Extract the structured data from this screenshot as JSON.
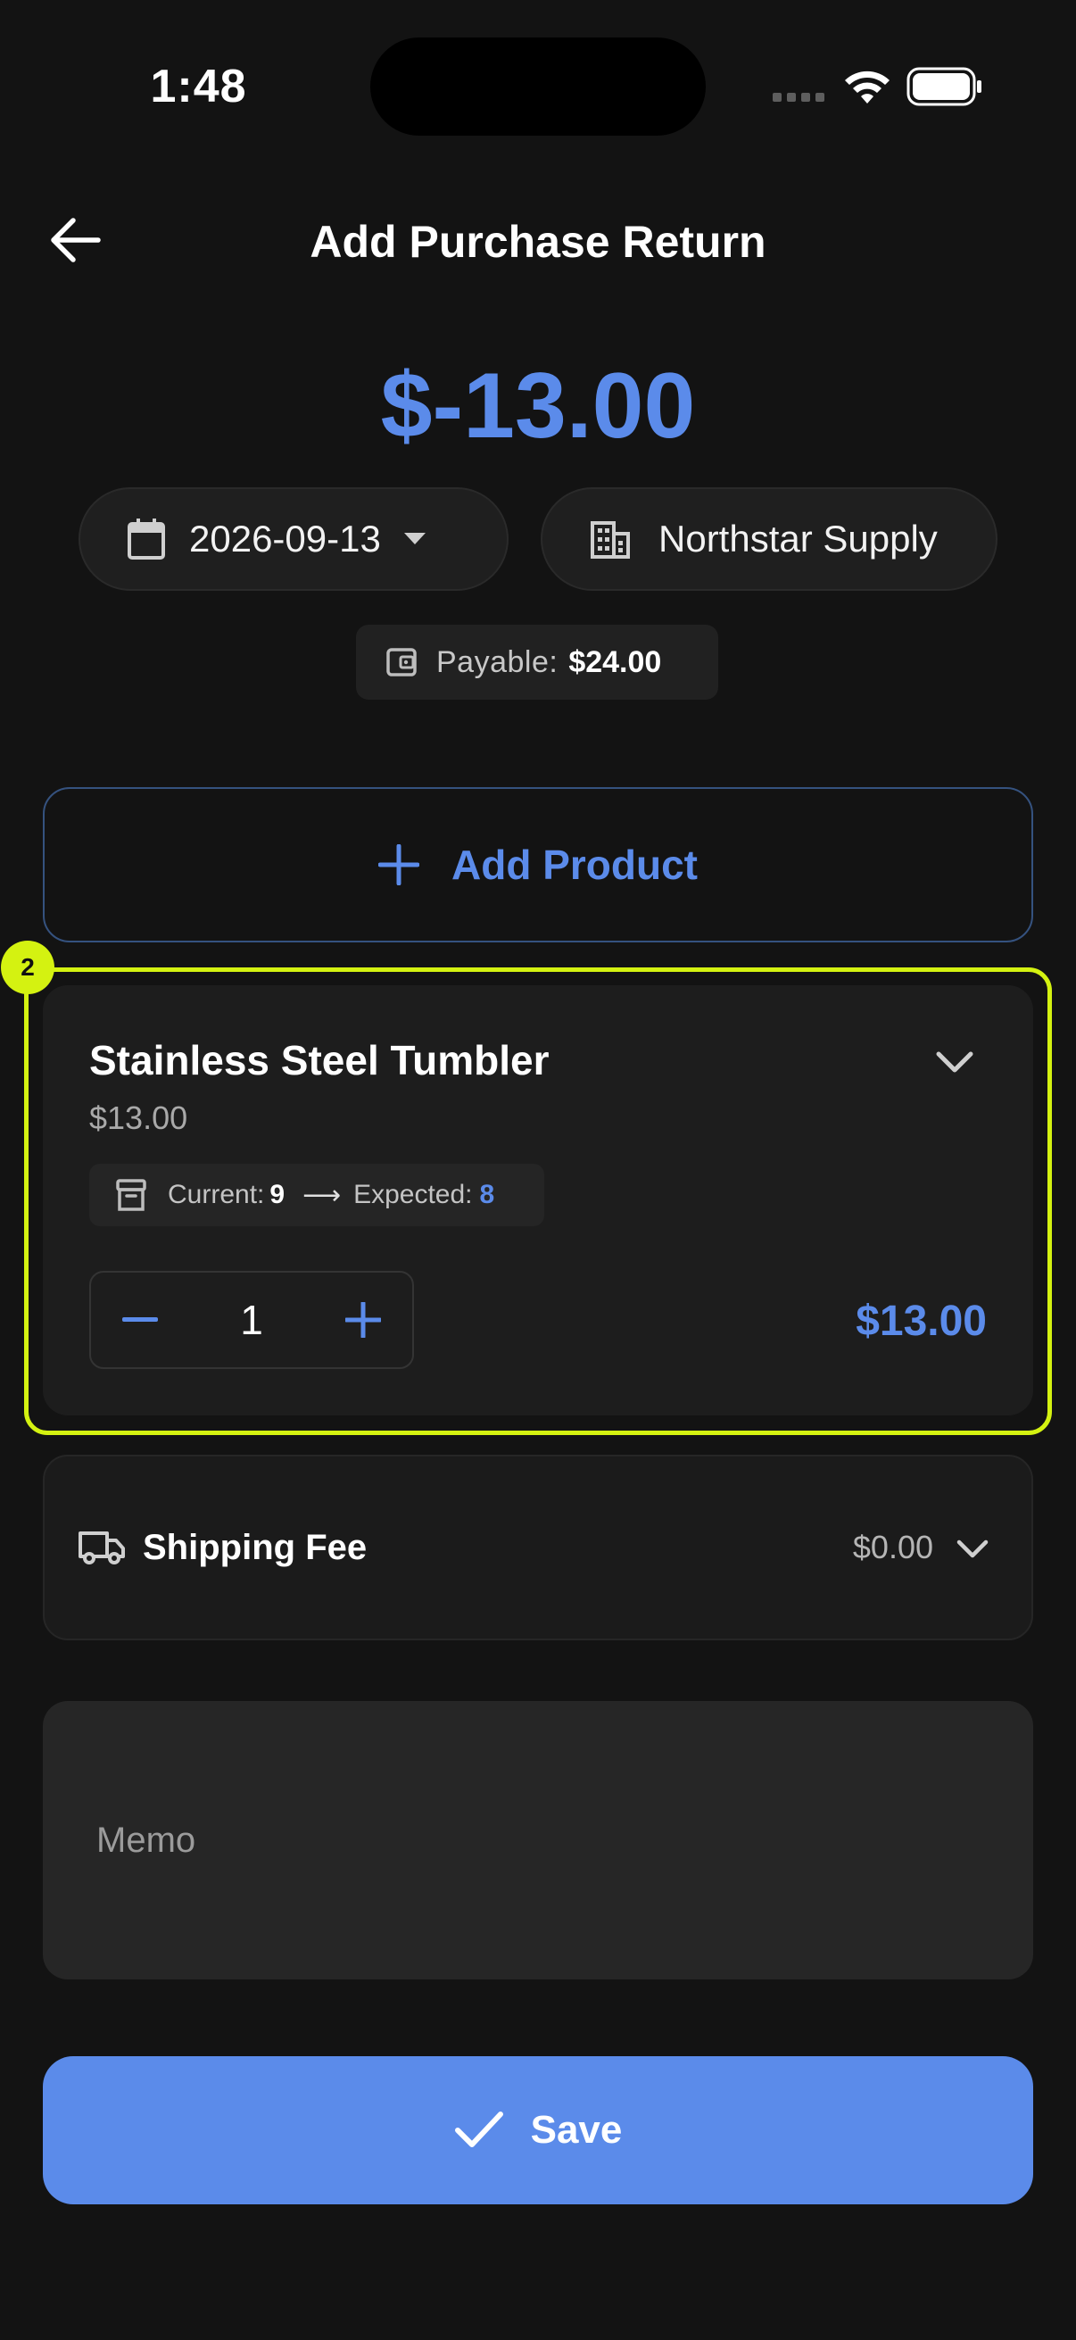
{
  "status_bar": {
    "time": "1:48"
  },
  "header": {
    "title": "Add Purchase Return"
  },
  "summary": {
    "total": "$-13.00",
    "date": "2026-09-13",
    "supplier": "Northstar Supply",
    "payable_label": "Payable:",
    "payable_value": "$24.00"
  },
  "add_product": {
    "label": "Add Product"
  },
  "product": {
    "badge": "2",
    "name": "Stainless Steel Tumbler",
    "price": "$13.00",
    "current_label": "Current:",
    "current_value": "9",
    "arrow": "⟶",
    "expected_label": "Expected:",
    "expected_value": "8",
    "quantity": "1",
    "line_total": "$13.00"
  },
  "shipping": {
    "label": "Shipping Fee",
    "value": "$0.00"
  },
  "memo": {
    "placeholder": "Memo"
  },
  "save": {
    "label": "Save"
  },
  "colors": {
    "accent": "#5b8bea",
    "highlight": "#d4f211",
    "background": "#131313"
  }
}
